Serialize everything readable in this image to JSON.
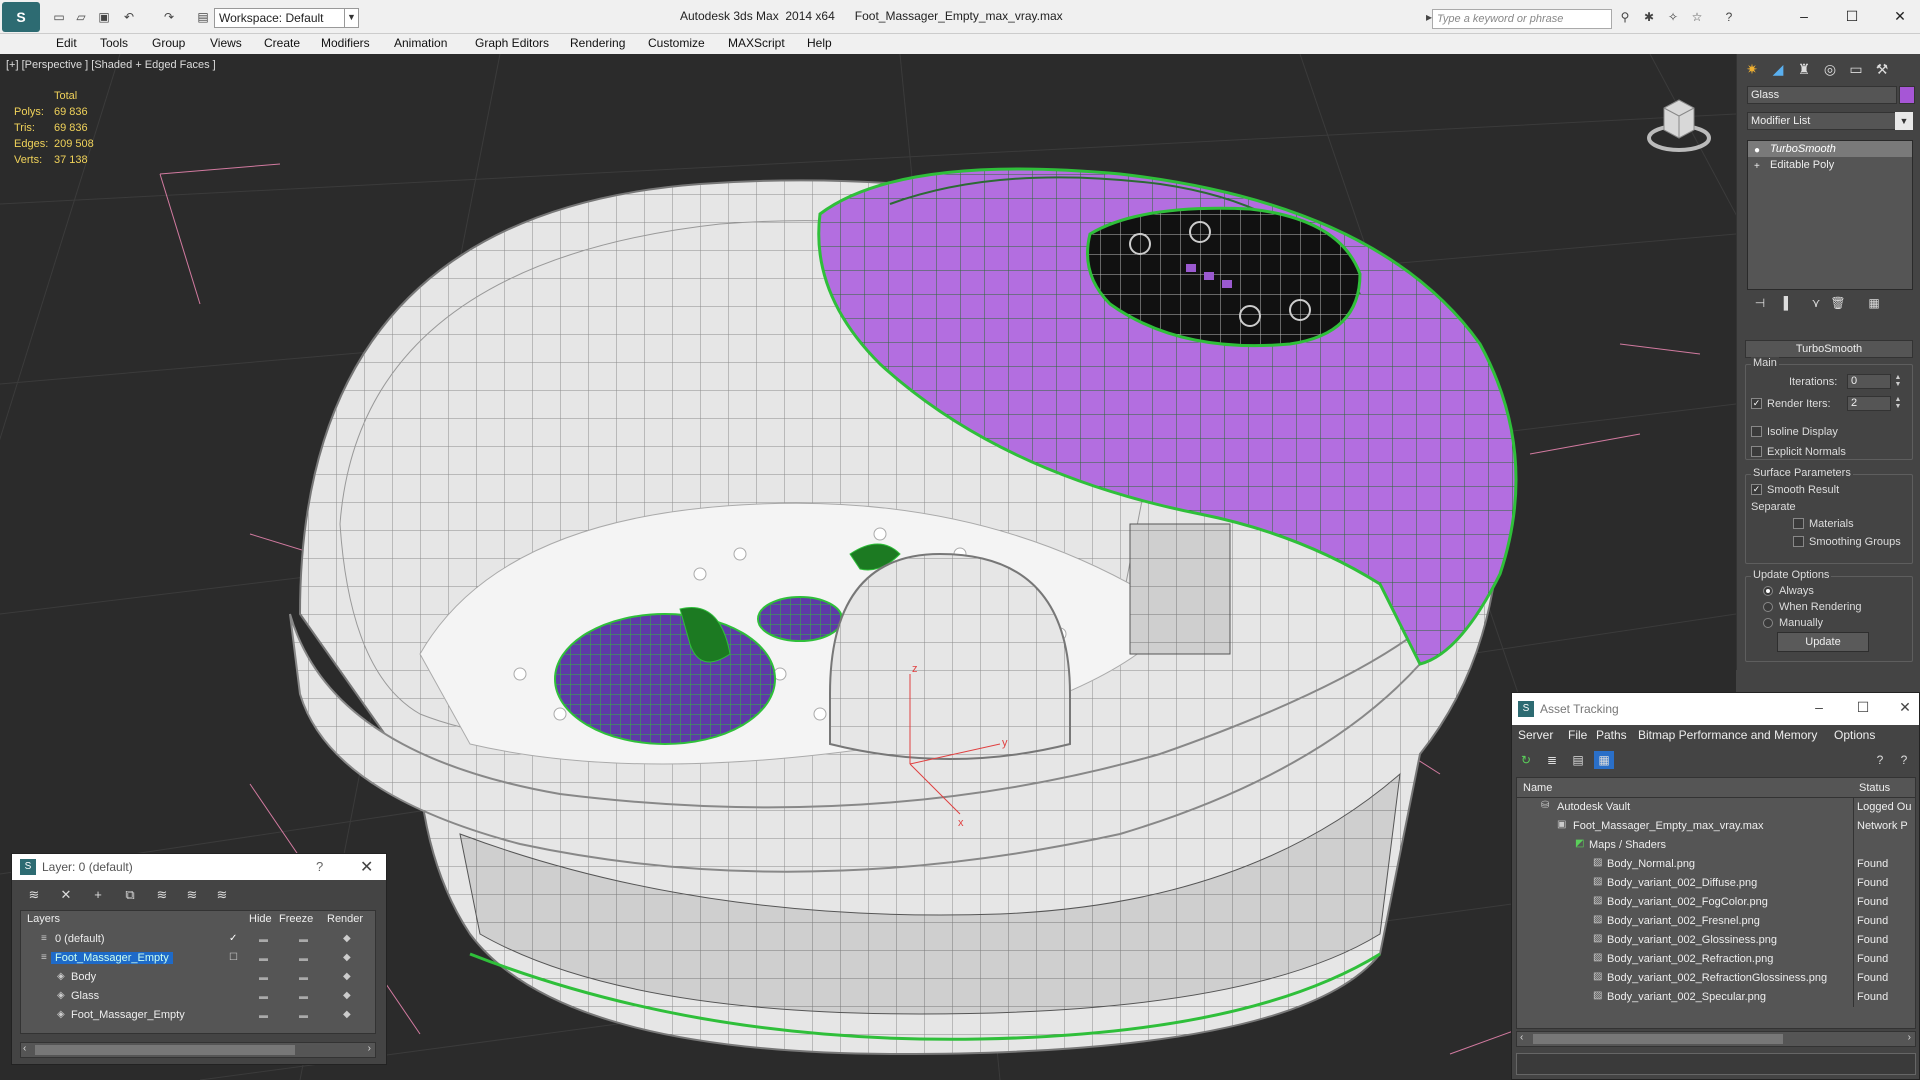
{
  "app": {
    "window_title": "Autodesk 3ds Max  2014 x64      Foot_Massager_Empty_max_vray.max",
    "workspace": "Workspace: Default",
    "search_placeholder": "Type a keyword or phrase"
  },
  "menu": [
    "Edit",
    "Tools",
    "Group",
    "Views",
    "Create",
    "Modifiers",
    "Animation",
    "Graph Editors",
    "Rendering",
    "Customize",
    "MAXScript",
    "Help"
  ],
  "viewport": {
    "label": "[+] [Perspective ] [Shaded + Edged Faces ]",
    "stats": {
      "header": "Total",
      "rows": [
        {
          "k": "Polys:",
          "v": "69 836"
        },
        {
          "k": "Tris:",
          "v": "69 836"
        },
        {
          "k": "Edges:",
          "v": "209 508"
        },
        {
          "k": "Verts:",
          "v": "37 138"
        }
      ]
    },
    "axis_labels": {
      "x": "x",
      "y": "y",
      "z": "z"
    }
  },
  "command_panel": {
    "object_name": "Glass",
    "object_color": "#a656d6",
    "modifier_list": "Modifier List",
    "stack": [
      "TurboSmooth",
      "Editable Poly"
    ],
    "rollout": "TurboSmooth",
    "main": {
      "label": "Main",
      "iterations_label": "Iterations:",
      "iterations": "0",
      "render_iters_label": "Render Iters:",
      "render_iters": "2",
      "isoline": "Isoline Display",
      "explicit": "Explicit Normals"
    },
    "surface": {
      "label": "Surface Parameters",
      "smooth": "Smooth Result",
      "separate": "Separate",
      "materials": "Materials",
      "smoothing_groups": "Smoothing Groups"
    },
    "update": {
      "label": "Update Options",
      "always": "Always",
      "when_rendering": "When Rendering",
      "manually": "Manually",
      "button": "Update"
    }
  },
  "layer_dialog": {
    "title": "Layer: 0 (default)",
    "help": "?",
    "columns": {
      "layers": "Layers",
      "hide": "Hide",
      "freeze": "Freeze",
      "render": "Render"
    },
    "rows": [
      {
        "name": "0 (default)",
        "indent": 0
      },
      {
        "name": "Foot_Massager_Empty",
        "indent": 0
      },
      {
        "name": "Body",
        "indent": 1
      },
      {
        "name": "Glass",
        "indent": 1
      },
      {
        "name": "Foot_Massager_Empty",
        "indent": 1
      }
    ]
  },
  "asset_dialog": {
    "title": "Asset Tracking",
    "menu": [
      "Server",
      "File",
      "Paths",
      "Bitmap Performance and Memory",
      "Options"
    ],
    "columns": {
      "name": "Name",
      "status": "Status"
    },
    "rows": [
      {
        "name": "Autodesk Vault",
        "status": "Logged Ou",
        "indent": 0
      },
      {
        "name": "Foot_Massager_Empty_max_vray.max",
        "status": "Network P",
        "indent": 1
      },
      {
        "name": "Maps / Shaders",
        "status": "",
        "indent": 2
      },
      {
        "name": "Body_Normal.png",
        "status": "Found",
        "indent": 3
      },
      {
        "name": "Body_variant_002_Diffuse.png",
        "status": "Found",
        "indent": 3
      },
      {
        "name": "Body_variant_002_FogColor.png",
        "status": "Found",
        "indent": 3
      },
      {
        "name": "Body_variant_002_Fresnel.png",
        "status": "Found",
        "indent": 3
      },
      {
        "name": "Body_variant_002_Glossiness.png",
        "status": "Found",
        "indent": 3
      },
      {
        "name": "Body_variant_002_Refraction.png",
        "status": "Found",
        "indent": 3
      },
      {
        "name": "Body_variant_002_RefractionGlossiness.png",
        "status": "Found",
        "indent": 3
      },
      {
        "name": "Body_variant_002_Specular.png",
        "status": "Found",
        "indent": 3
      }
    ]
  },
  "colors": {
    "selection_purple": "#a656d6",
    "wire_green": "#2fbf3a",
    "stats_yellow": "#f0d25a"
  }
}
